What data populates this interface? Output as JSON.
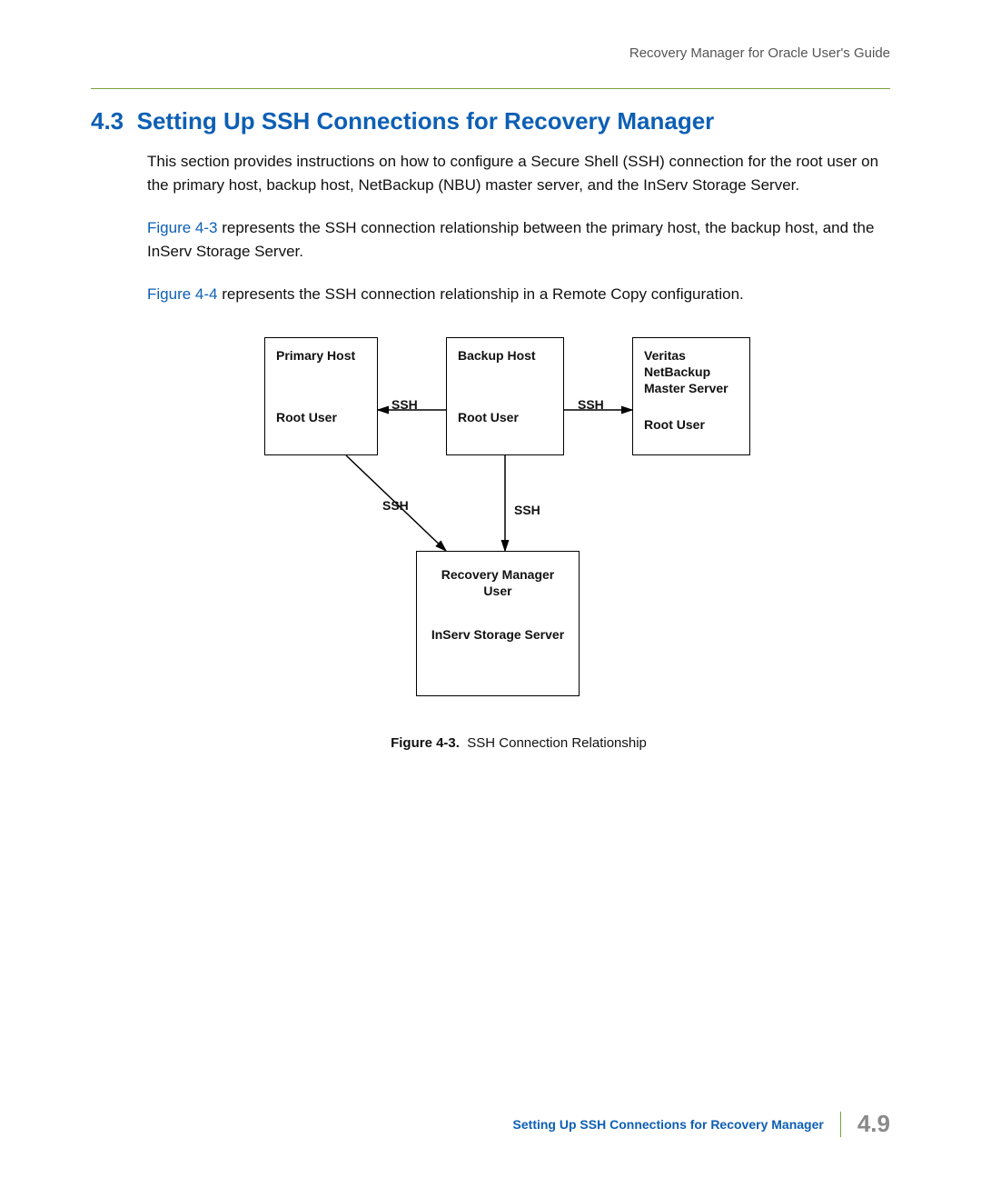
{
  "header": {
    "doc_title": "Recovery Manager for Oracle User's Guide"
  },
  "section": {
    "number": "4.3",
    "title": "Setting Up SSH Connections for Recovery Manager",
    "para1": "This section provides instructions on how to configure a Secure Shell (SSH) connection for the root user on the primary host, backup host, NetBackup (NBU) master server, and the InServ Storage Server.",
    "para2_a": "Figure 4-3",
    "para2_b": " represents the SSH connection relationship between the primary host, the backup host, and the InServ Storage Server.",
    "para3_a": "Figure 4-4",
    "para3_b": " represents the SSH connection relationship in a Remote Copy configuration."
  },
  "diagram": {
    "box1": {
      "title": "Primary Host",
      "bottom": "Root User"
    },
    "box2": {
      "title": "Backup Host",
      "bottom": "Root User"
    },
    "box3": {
      "title": "Veritas NetBackup Master Server",
      "bottom": "Root User"
    },
    "box4": {
      "title": "Recovery Manager User",
      "subtitle": "InServ Storage Server"
    },
    "edge_ssh": "SSH"
  },
  "caption": {
    "label": "Figure 4-3.",
    "text": "SSH Connection Relationship"
  },
  "footer": {
    "title": "Setting Up SSH Connections for Recovery Manager",
    "page": "4.9"
  }
}
